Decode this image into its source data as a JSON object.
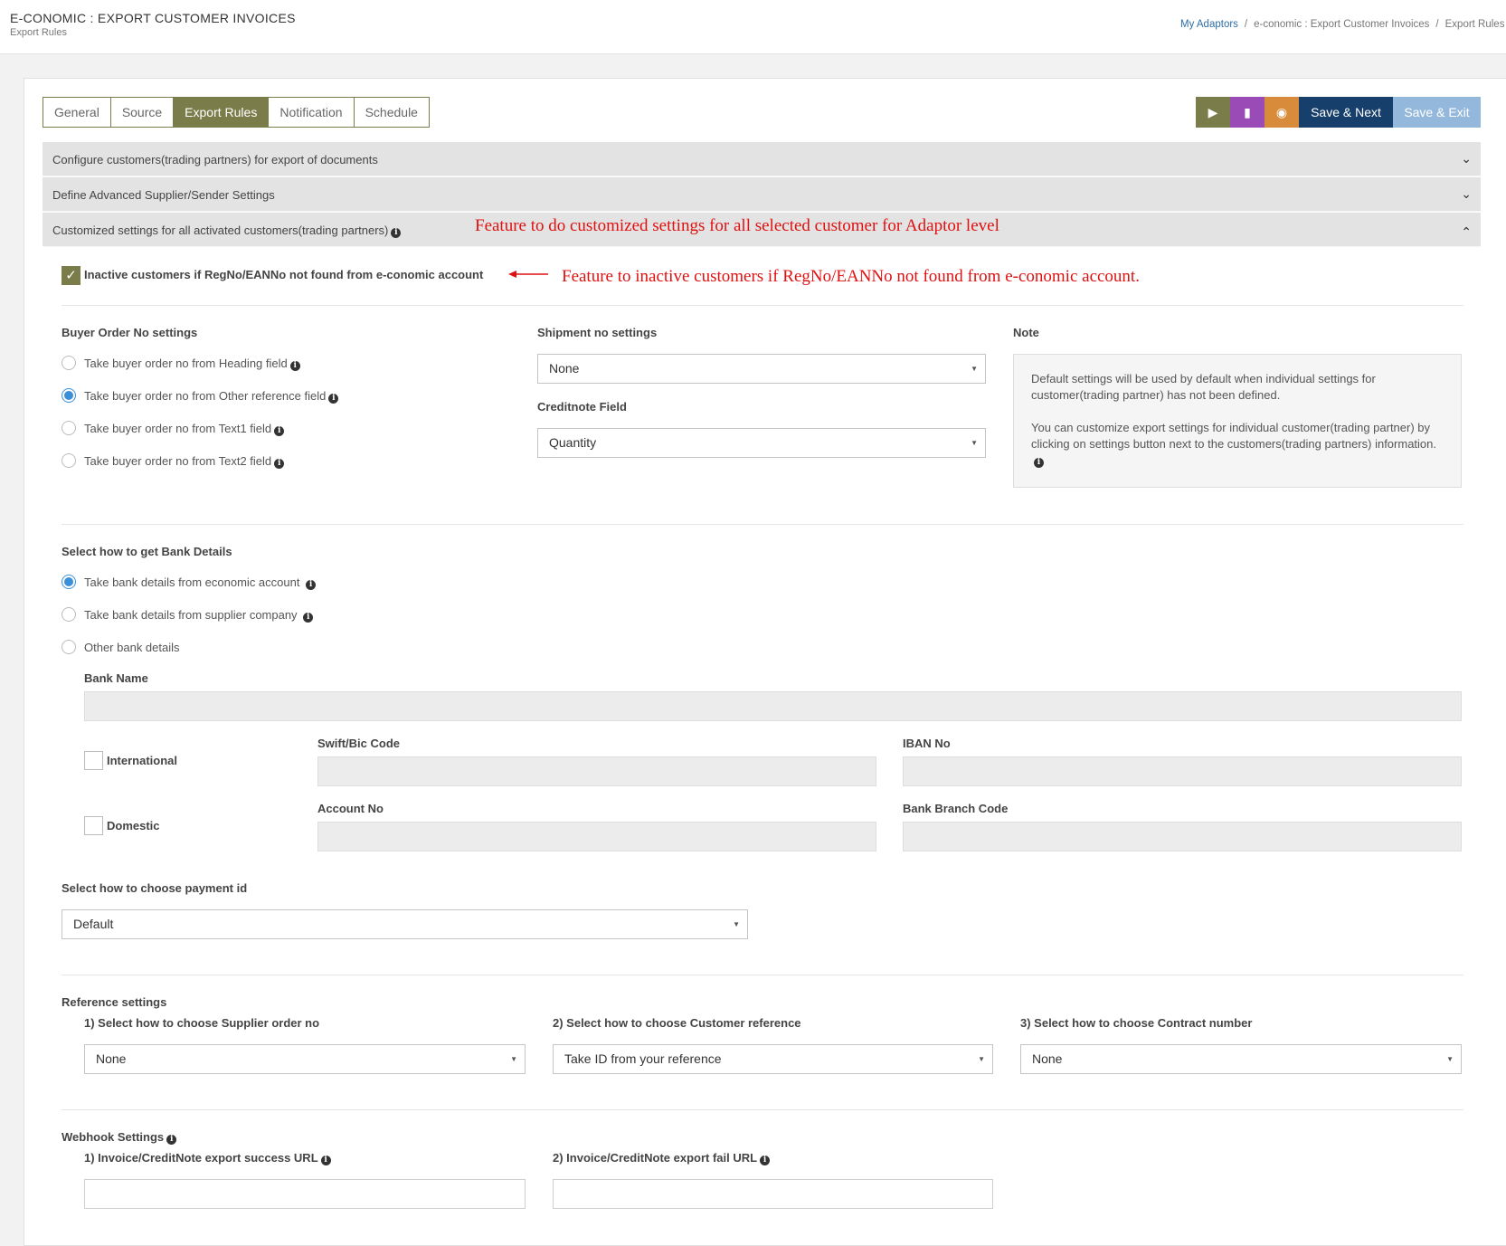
{
  "header": {
    "title": "E-CONOMIC : EXPORT CUSTOMER INVOICES",
    "subtitle": "Export Rules",
    "breadcrumb": [
      "My Adaptors",
      "e-conomic : Export Customer Invoices",
      "Export Rules"
    ]
  },
  "tabs": [
    {
      "label": "General"
    },
    {
      "label": "Source"
    },
    {
      "label": "Export Rules",
      "active": true
    },
    {
      "label": "Notification"
    },
    {
      "label": "Schedule"
    }
  ],
  "toolbar": {
    "play_icon": "play-icon",
    "book_icon": "book-icon",
    "dashboard_icon": "dashboard-icon",
    "save_next": "Save & Next",
    "save_exit": "Save & Exit"
  },
  "accordion": {
    "section1": "Configure customers(trading partners) for export of documents",
    "section2": "Define Advanced Supplier/Sender Settings",
    "section3": "Customized settings for all activated customers(trading partners)"
  },
  "annotations": {
    "a1": "Feature to do customized settings for all selected customer for Adaptor level",
    "a2": "Feature to inactive customers if RegNo/EANNo not found from e-conomic account."
  },
  "inactive_customers": {
    "label": "Inactive customers if RegNo/EANNo not found from e-conomic account",
    "checked": true
  },
  "buyer_order": {
    "title": "Buyer Order No settings",
    "options": [
      {
        "label": "Take buyer order no from Heading field",
        "selected": false
      },
      {
        "label": "Take buyer order no from Other reference field",
        "selected": true
      },
      {
        "label": "Take buyer order no from Text1 field",
        "selected": false
      },
      {
        "label": "Take buyer order no from Text2 field",
        "selected": false
      }
    ]
  },
  "shipment": {
    "title": "Shipment no settings",
    "value": "None",
    "creditnote_title": "Creditnote Field",
    "creditnote_value": "Quantity"
  },
  "note": {
    "title": "Note",
    "p1": "Default settings will be used by default when individual settings for customer(trading partner) has not been defined.",
    "p2": "You can customize export settings for individual customer(trading partner) by clicking on settings button next to the customers(trading partners) information."
  },
  "bank": {
    "title": "Select how to get Bank Details",
    "options": [
      {
        "label": "Take bank details from economic account",
        "selected": true
      },
      {
        "label": "Take bank details from supplier company",
        "selected": false
      },
      {
        "label": "Other bank details",
        "selected": false
      }
    ],
    "bank_name_label": "Bank Name",
    "international_label": "International",
    "domestic_label": "Domestic",
    "swift_label": "Swift/Bic Code",
    "iban_label": "IBAN No",
    "account_label": "Account No",
    "branch_label": "Bank Branch Code"
  },
  "payment": {
    "title": "Select how to choose payment id",
    "value": "Default"
  },
  "reference": {
    "title": "Reference settings",
    "supplier_label": "1) Select how to choose Supplier order no",
    "supplier_value": "None",
    "customer_label": "2) Select how to choose Customer reference",
    "customer_value": "Take ID from your reference",
    "contract_label": "3) Select how to choose Contract number",
    "contract_value": "None"
  },
  "webhook": {
    "title": "Webhook Settings",
    "success_label": "1) Invoice/CreditNote export success URL",
    "fail_label": "2) Invoice/CreditNote export fail URL"
  }
}
